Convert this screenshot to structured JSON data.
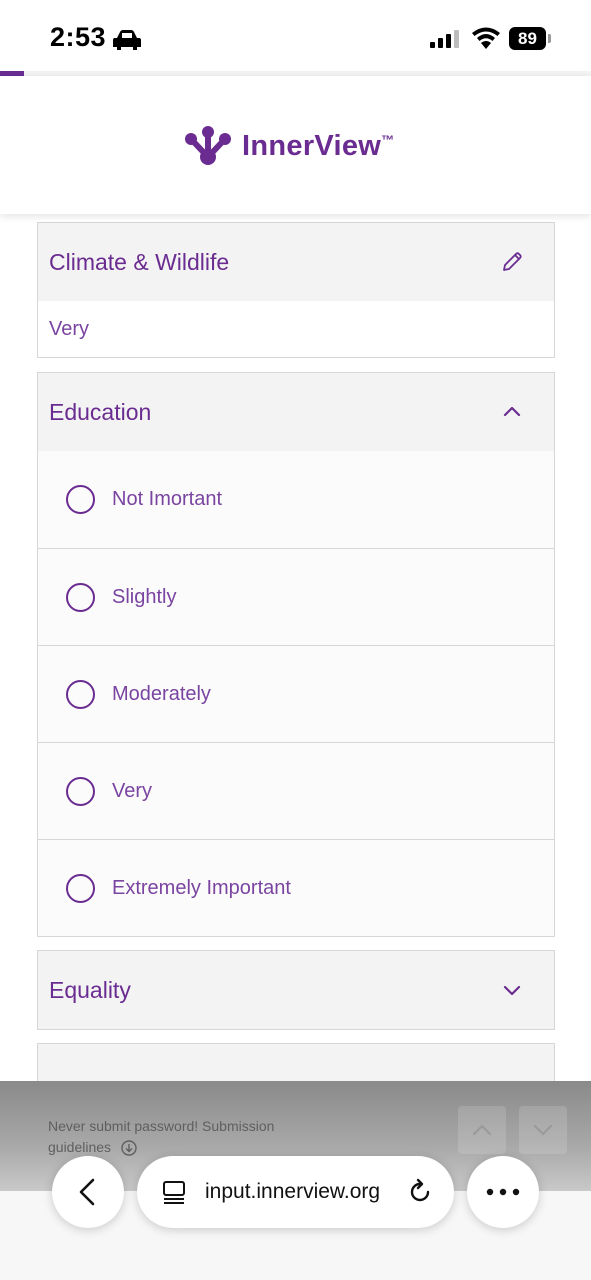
{
  "status_bar": {
    "time": "2:53",
    "battery": "89"
  },
  "progress": {
    "fraction": 0.04
  },
  "brand": {
    "name": "InnerView",
    "tm": "™",
    "color": "#6a2c91"
  },
  "questions": [
    {
      "title": "Climate & Wildlife",
      "state": "answered",
      "answer": "Very"
    },
    {
      "title": "Education",
      "state": "expanded",
      "options": [
        "Not Imortant",
        "Slightly",
        "Moderately",
        "Very",
        "Extremely Important"
      ]
    },
    {
      "title": "Equality",
      "state": "collapsed"
    }
  ],
  "footer": {
    "notice": "Never submit password! Submission guidelines"
  },
  "browser": {
    "url": "input.innerview.org"
  }
}
